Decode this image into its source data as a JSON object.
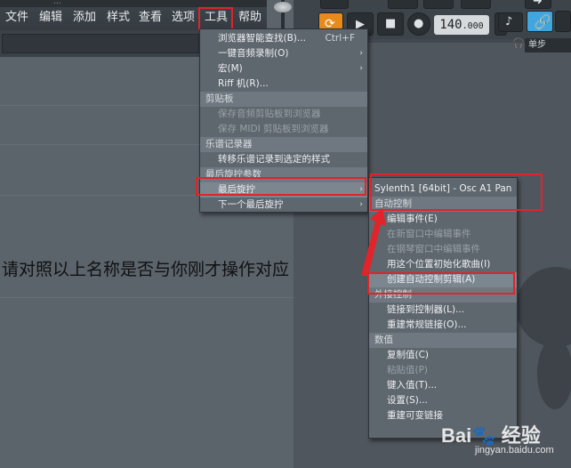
{
  "menubar": {
    "top_text": "...",
    "items": [
      "文件",
      "编辑",
      "添加",
      "样式",
      "查看",
      "选项",
      "工具",
      "帮助"
    ]
  },
  "toolbar": {
    "tempo_int": "140",
    "tempo_dec": ".000",
    "mode_dropdown": "单步"
  },
  "tools_menu": {
    "items": [
      {
        "label": "浏览器智能查找(B)...",
        "shortcut": "Ctrl+F",
        "type": "item"
      },
      {
        "label": "一键音频录制(O)",
        "arrow": "›",
        "type": "item"
      },
      {
        "label": "宏(M)",
        "arrow": "›",
        "type": "item"
      },
      {
        "label": "Riff 机(R)...",
        "type": "item"
      },
      {
        "label": "剪贴板",
        "type": "header"
      },
      {
        "label": "保存音频剪贴板到浏览器",
        "type": "disabled"
      },
      {
        "label": "保存 MIDI 剪贴板到浏览器",
        "type": "disabled"
      },
      {
        "label": "乐谱记录器",
        "type": "header"
      },
      {
        "label": "转移乐谱记录到选定的样式",
        "type": "item"
      },
      {
        "label": "最后旋拧参数",
        "type": "header"
      },
      {
        "label": "最后旋拧",
        "arrow": "›",
        "type": "highlight"
      },
      {
        "label": "下一个最后旋拧",
        "arrow": "›",
        "type": "item"
      }
    ]
  },
  "submenu": {
    "title": "Sylenth1 [64bit] - Osc A1 Pan",
    "items": [
      {
        "label": "自动控制",
        "type": "header"
      },
      {
        "label": "编辑事件(E)",
        "type": "item"
      },
      {
        "label": "在新窗口中编辑事件",
        "type": "disabled"
      },
      {
        "label": "在钢琴窗口中编辑事件",
        "type": "disabled"
      },
      {
        "label": "用这个位置初始化歌曲(I)",
        "type": "item"
      },
      {
        "label": "创建自动控制剪辑(A)",
        "type": "highlight"
      },
      {
        "label": "外接控制",
        "type": "header"
      },
      {
        "label": "链接到控制器(L)...",
        "type": "item"
      },
      {
        "label": "重建常规链接(O)...",
        "type": "item"
      },
      {
        "label": "数值",
        "type": "header"
      },
      {
        "label": "复制值(C)",
        "type": "item"
      },
      {
        "label": "粘贴值(P)",
        "type": "disabled"
      },
      {
        "label": "键入值(T)...",
        "type": "item"
      },
      {
        "label": "设置(S)...",
        "type": "item"
      },
      {
        "label": "重建可变链接",
        "type": "item"
      }
    ]
  },
  "annotation_text": "请对照以上名称是否与你刚才操作对应",
  "watermark": {
    "logo": "Bai🐾 经验",
    "url": "jingyan.baidu.com"
  },
  "colors": {
    "accent_red": "#e2232a",
    "menu_bg": "#5e666e",
    "header_bg": "#6f7880",
    "highlight_bg": "#7c868e"
  }
}
